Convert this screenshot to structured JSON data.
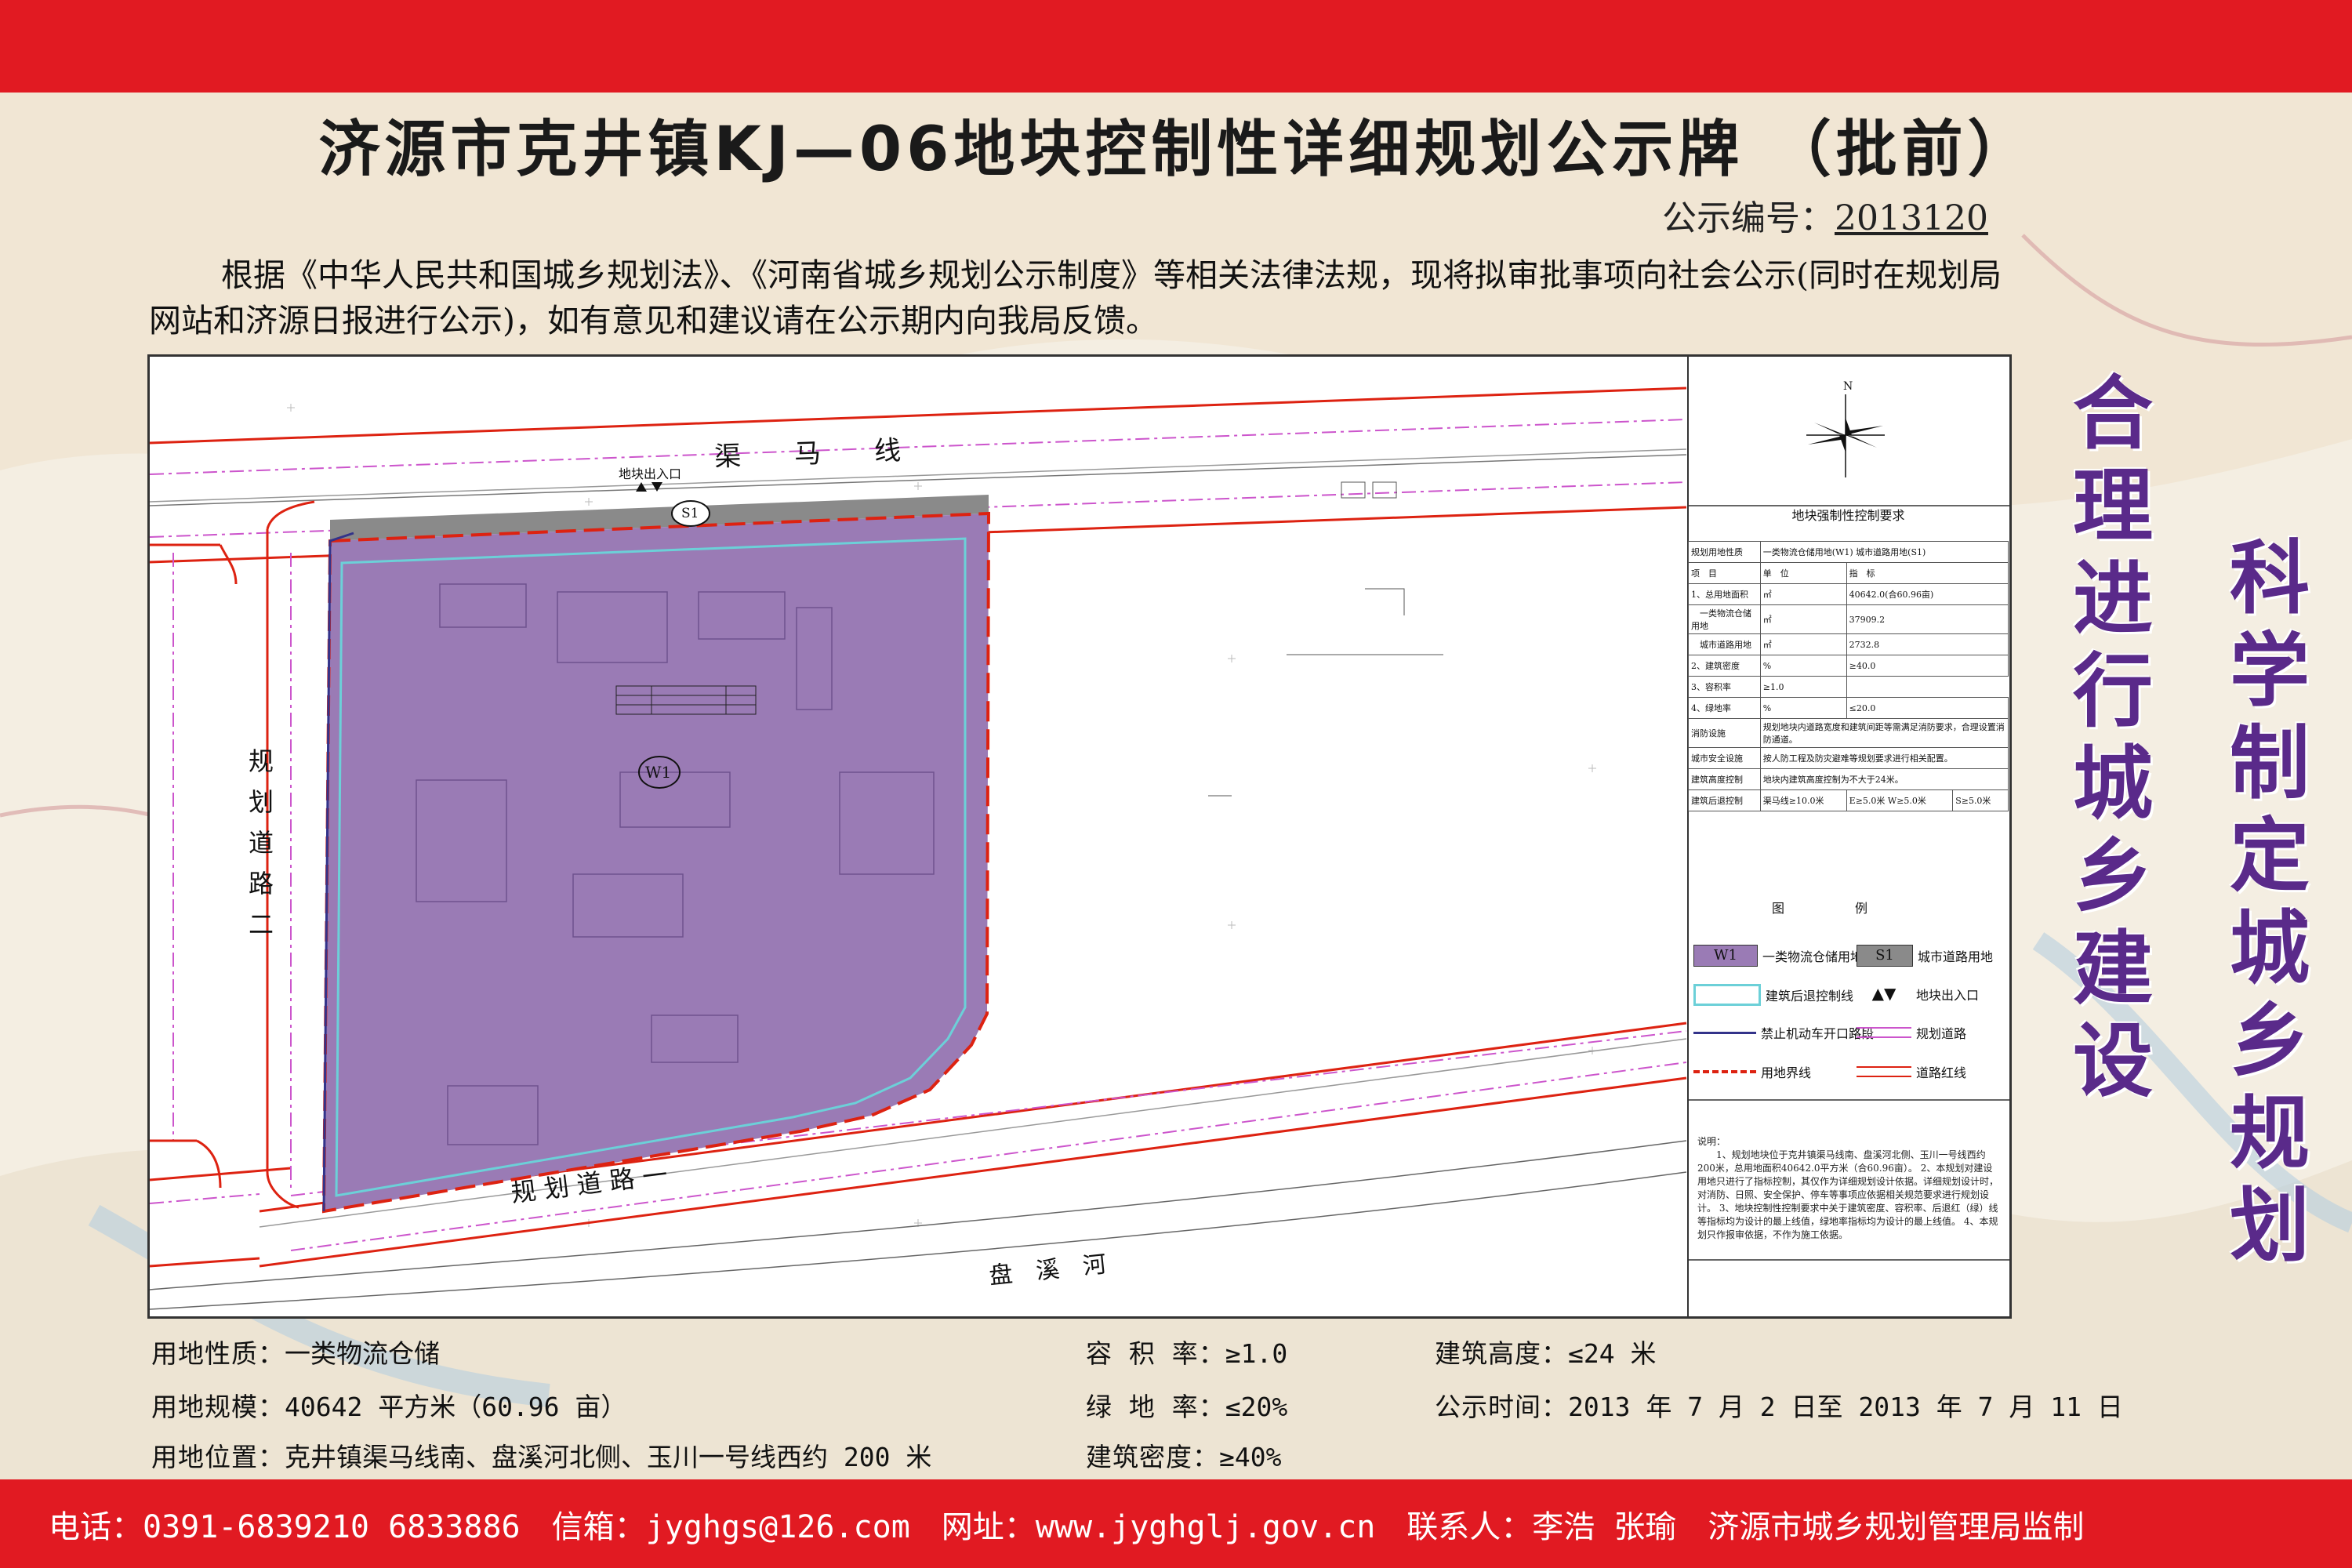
{
  "title": "济源市克井镇KJ—06地块控制性详细规划公示牌 （批前）",
  "notice": {
    "label": "公示编号：",
    "number": "2013120"
  },
  "intro": "根据《中华人民共和国城乡规划法》、《河南省城乡规划公示制度》等相关法律法规，现将拟审批事项向社会公示(同时在规划局网站和济源日报进行公示)，如有意见和建议请在公示期内向我局反馈。",
  "slogans": {
    "left": "合理进行城乡建设",
    "right": "科学制定城乡规划"
  },
  "map": {
    "roads": {
      "top": "渠　　马　　线",
      "left": "规划道路二",
      "bottom": "规 划 道 路 一",
      "river": "盘　溪　河"
    },
    "entrance": "地块出入口",
    "parcel_w1": "W1",
    "parcel_s1": "S1",
    "north": "N"
  },
  "panel": {
    "title": "地块强制性控制要求",
    "rows": [
      [
        "规划用地性质",
        "一类物流仓储用地(W1) 城市道路用地(S1)",
        "",
        ""
      ],
      [
        "项　目",
        "单　位",
        "指　标",
        ""
      ],
      [
        "1、总用地面积",
        "㎡",
        "40642.0(合60.96亩)",
        ""
      ],
      [
        "　一类物流仓储用地",
        "㎡",
        "37909.2",
        ""
      ],
      [
        "　城市道路用地",
        "㎡",
        "2732.8",
        ""
      ],
      [
        "2、建筑密度",
        "%",
        "≥40.0",
        ""
      ],
      [
        "3、容积率",
        "",
        "≥1.0",
        ""
      ],
      [
        "4、绿地率",
        "%",
        "≤20.0",
        ""
      ],
      [
        "消防设施",
        "规划地块内道路宽度和建筑间距等需满足消防要求，合理设置消防通道。",
        "",
        ""
      ],
      [
        "城市安全设施",
        "按人防工程及防灾避难等规划要求进行相关配置。",
        "",
        ""
      ],
      [
        "建筑高度控制",
        "地块内建筑高度控制为不大于24米。",
        "",
        ""
      ],
      [
        "建筑后退控制",
        "渠马线≥10.0米",
        "E≥5.0米 W≥5.0米",
        "S≥5.0米"
      ]
    ],
    "legend_title": "图例",
    "legend": [
      {
        "key": "W1",
        "label": "一类物流仓储用地"
      },
      {
        "key": "S1",
        "label": "城市道路用地"
      },
      {
        "key": "setback",
        "label": "建筑后退控制线"
      },
      {
        "key": "entrance",
        "label": "地块出入口"
      },
      {
        "key": "no-open",
        "label": "禁止机动车开口路段"
      },
      {
        "key": "planned-road",
        "label": "规划道路"
      },
      {
        "key": "boundary",
        "label": "用地界线"
      },
      {
        "key": "red-line",
        "label": "道路红线"
      }
    ],
    "notes_title": "说明：",
    "notes": "1、规划地块位于克井镇渠马线南、盘溪河北侧、玉川一号线西约200米，总用地面积40642.0平方米（合60.96亩）。 2、本规划对建设用地只进行了指标控制，其仅作为详细规划设计依据。详细规划设计时，对消防、日照、安全保护、停车等事项应依据相关规范要求进行规划设计。 3、地块控制性控制要求中关于建筑密度、容积率、后退红（绿）线等指标均为设计的最上线值，绿地率指标均为设计的最上线值。 4、本规划只作报审依据，不作为施工依据。"
  },
  "info": {
    "use_label": "用地性质：",
    "use": "一类物流仓储",
    "scale_label": "用地规模：",
    "scale": "40642 平方米（60.96 亩）",
    "loc_label": "用地位置：",
    "loc": "克井镇渠马线南、盘溪河北侧、玉川一号线西约 200 米",
    "far_label": "容 积 率：",
    "far": "≥1.0",
    "green_label": "绿 地 率：",
    "green": "≤20%",
    "density_label": "建筑密度：",
    "density": "≥40%",
    "height_label": "建筑高度：",
    "height": "≤24 米",
    "time_label": "公示时间：",
    "time": "2013 年 7 月 2 日至 2013 年 7 月 11 日"
  },
  "footer": {
    "phone": "电话：0391-6839210 6833886",
    "email": "信箱：jyghgs@126.com",
    "web": "网址：www.jyghglj.gov.cn",
    "contact": "联系人：李浩 张瑜",
    "org": "济源市城乡规划管理局监制"
  },
  "colors": {
    "banner": "#e11a22",
    "parcel": "#9a7bb5",
    "road_s1": "#8a8a8a",
    "slogan": "#5a2a8a"
  }
}
